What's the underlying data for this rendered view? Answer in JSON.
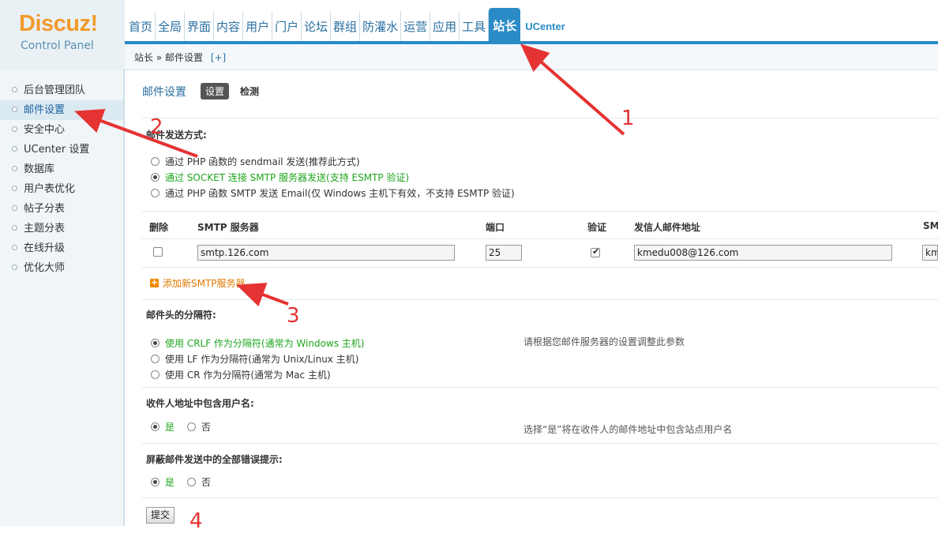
{
  "logo": {
    "brand": "Discuz!",
    "subtitle": "Control Panel"
  },
  "topnav": [
    "首页",
    "全局",
    "界面",
    "内容",
    "用户",
    "门户",
    "论坛",
    "群组",
    "防灌水",
    "运营",
    "应用",
    "工具",
    "站长",
    "UCenter"
  ],
  "active_nav": "站长",
  "breadcrumb": {
    "path": "站长 » 邮件设置",
    "toggle": "[+]"
  },
  "sidebar": [
    "后台管理团队",
    "邮件设置",
    "安全中心",
    "UCenter 设置",
    "数据库",
    "用户表优化",
    "帖子分表",
    "主题分表",
    "在线升级",
    "优化大师"
  ],
  "main": {
    "title": "邮件设置",
    "tab_settings": "设置",
    "tab_check": "检测",
    "send_method": {
      "label": "邮件发送方式:",
      "options": [
        "通过 PHP 函数的 sendmail 发送(推荐此方式)",
        "通过 SOCKET 连接 SMTP 服务器发送(支持 ESMTP 验证)",
        "通过 PHP 函数 SMTP 发送 Email(仅 Windows 主机下有效，不支持 ESMTP 验证)"
      ],
      "selected": 1
    },
    "smtp_table": {
      "headers": [
        "删除",
        "SMTP 服务器",
        "端口",
        "验证",
        "发信人邮件地址",
        "SM"
      ],
      "row": {
        "server": "smtp.126.com",
        "port": "25",
        "auth": true,
        "from": "kmedu008@126.com",
        "user": "km"
      }
    },
    "add_server": "添加新SMTP服务器",
    "delimiter": {
      "label": "邮件头的分隔符:",
      "options": [
        "使用 CRLF 作为分隔符(通常为 Windows 主机)",
        "使用 LF 作为分隔符(通常为 Unix/Linux 主机)",
        "使用 CR 作为分隔符(通常为 Mac 主机)"
      ],
      "selected": 0,
      "hint": "请根据您邮件服务器的设置调整此参数"
    },
    "include_username": {
      "label": "收件人地址中包含用户名:",
      "yes": "是",
      "no": "否",
      "hint": "选择“是”将在收件人的邮件地址中包含站点用户名"
    },
    "silent_errors": {
      "label": "屏蔽邮件发送中的全部错误提示:",
      "yes": "是",
      "no": "否"
    },
    "submit": "提交"
  },
  "annotations": {
    "n1": "1",
    "n2": "2",
    "n3": "3",
    "n4": "4"
  },
  "colors": {
    "accent": "#2a8bc7",
    "annotation": "#e53333",
    "selected_text": "#1ea51e",
    "logo": "#f39a2c"
  }
}
